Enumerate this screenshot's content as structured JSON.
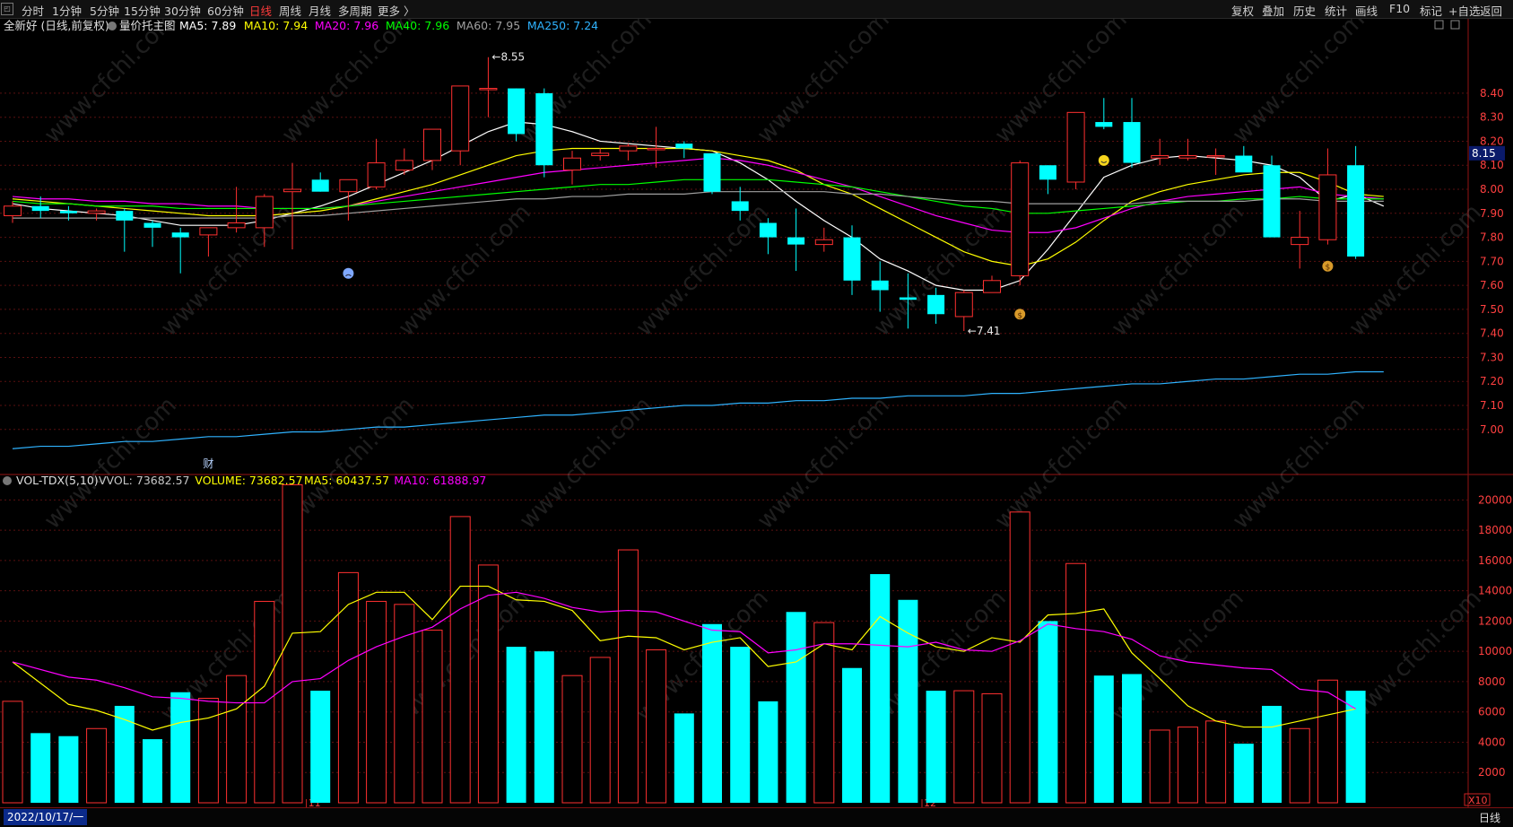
{
  "toolbar": {
    "left_items": [
      "分时",
      "1分钟",
      "5分钟",
      "15分钟",
      "30分钟",
      "60分钟",
      "日线",
      "周线",
      "月线",
      "多周期",
      "更多 〉"
    ],
    "active_index": 6,
    "right_items": [
      "复权",
      "叠加",
      "历史",
      "统计",
      "画线",
      "F10",
      "标记",
      "+自选",
      "返回"
    ]
  },
  "main_legend": {
    "stock": "全新好 (日线,前复权)",
    "indicator": "量价托主图",
    "items": [
      {
        "label": "MA5: 7.89",
        "color": "#ffffff"
      },
      {
        "label": "MA10: 7.94",
        "color": "#ffff00"
      },
      {
        "label": "MA20: 7.96",
        "color": "#ff00ff"
      },
      {
        "label": "MA40: 7.96",
        "color": "#00ff00"
      },
      {
        "label": "MA60: 7.95",
        "color": "#a0a0a0"
      },
      {
        "label": "MA250: 7.24",
        "color": "#2fb3ff"
      }
    ]
  },
  "vol_legend": {
    "indicator": "VOL-TDX(5,10)",
    "items": [
      {
        "label": "VVOL: 73682.57",
        "color": "#c8c8c8"
      },
      {
        "label": "VOLUME: 73682.57",
        "color": "#ffff00"
      },
      {
        "label": "MA5: 60437.57",
        "color": "#ffff00"
      },
      {
        "label": "MA10: 61888.97",
        "color": "#ff00ff"
      }
    ]
  },
  "footer": {
    "date": "2022/10/17/一",
    "timeframe": "日线"
  },
  "colors": {
    "up": "#ff3030",
    "down": "#00ffff",
    "grid": "#5a1010",
    "axis": "#ff4040",
    "vol_ma5": "#ffff00",
    "vol_ma10": "#ff00ff"
  },
  "chart_data": [
    {
      "type": "candlestick",
      "ylim": [
        6.82,
        8.62
      ],
      "y_ticks": [
        "8.40",
        "8.30",
        "8.20",
        "8.10",
        "8.00",
        "7.90",
        "7.80",
        "7.70",
        "7.60",
        "7.50",
        "7.40",
        "7.30",
        "7.20",
        "7.10",
        "7.00"
      ],
      "last_price": "8.15",
      "month_labels": [
        {
          "index": 11,
          "label": "11"
        },
        {
          "index": 33,
          "label": "12"
        }
      ],
      "annotations": [
        {
          "index": 17,
          "value": 8.55,
          "label": "8.55"
        },
        {
          "index": 34,
          "value": 7.41,
          "label": "7.41"
        }
      ],
      "markers": [
        {
          "index": 12,
          "value": 7.65,
          "icon": "sad-face"
        },
        {
          "index": 36,
          "value": 7.48,
          "icon": "money-bag"
        },
        {
          "index": 39,
          "value": 8.12,
          "icon": "smiley-face"
        },
        {
          "index": 47,
          "value": 7.68,
          "icon": "money-bag"
        }
      ],
      "text_markers": [
        {
          "index": 7,
          "label": "财"
        }
      ],
      "candles": [
        {
          "o": 7.89,
          "h": 7.95,
          "l": 7.86,
          "c": 7.93
        },
        {
          "o": 7.93,
          "h": 7.97,
          "l": 7.88,
          "c": 7.91
        },
        {
          "o": 7.91,
          "h": 7.93,
          "l": 7.87,
          "c": 7.9
        },
        {
          "o": 7.9,
          "h": 7.92,
          "l": 7.87,
          "c": 7.91
        },
        {
          "o": 7.91,
          "h": 7.92,
          "l": 7.74,
          "c": 7.87
        },
        {
          "o": 7.86,
          "h": 7.87,
          "l": 7.76,
          "c": 7.84
        },
        {
          "o": 7.82,
          "h": 7.84,
          "l": 7.65,
          "c": 7.8
        },
        {
          "o": 7.81,
          "h": 7.84,
          "l": 7.72,
          "c": 7.84
        },
        {
          "o": 7.84,
          "h": 8.01,
          "l": 7.82,
          "c": 7.86
        },
        {
          "o": 7.84,
          "h": 7.98,
          "l": 7.76,
          "c": 7.97
        },
        {
          "o": 7.99,
          "h": 8.11,
          "l": 7.75,
          "c": 8.0
        },
        {
          "o": 8.04,
          "h": 8.07,
          "l": 7.99,
          "c": 7.99
        },
        {
          "o": 7.99,
          "h": 8.04,
          "l": 7.87,
          "c": 8.04
        },
        {
          "o": 8.01,
          "h": 8.21,
          "l": 8.0,
          "c": 8.11
        },
        {
          "o": 8.08,
          "h": 8.17,
          "l": 8.06,
          "c": 8.12
        },
        {
          "o": 8.12,
          "h": 8.25,
          "l": 8.08,
          "c": 8.25
        },
        {
          "o": 8.16,
          "h": 8.43,
          "l": 8.1,
          "c": 8.43
        },
        {
          "o": 8.42,
          "h": 8.55,
          "l": 8.3,
          "c": 8.42
        },
        {
          "o": 8.42,
          "h": 8.42,
          "l": 8.2,
          "c": 8.23
        },
        {
          "o": 8.4,
          "h": 8.42,
          "l": 8.05,
          "c": 8.1
        },
        {
          "o": 8.08,
          "h": 8.16,
          "l": 8.02,
          "c": 8.13
        },
        {
          "o": 8.14,
          "h": 8.17,
          "l": 8.12,
          "c": 8.15
        },
        {
          "o": 8.16,
          "h": 8.19,
          "l": 8.12,
          "c": 8.18
        },
        {
          "o": 8.17,
          "h": 8.26,
          "l": 8.09,
          "c": 8.17
        },
        {
          "o": 8.19,
          "h": 8.2,
          "l": 8.13,
          "c": 8.17
        },
        {
          "o": 8.15,
          "h": 8.15,
          "l": 7.98,
          "c": 7.99
        },
        {
          "o": 7.95,
          "h": 8.01,
          "l": 7.87,
          "c": 7.91
        },
        {
          "o": 7.86,
          "h": 7.88,
          "l": 7.73,
          "c": 7.8
        },
        {
          "o": 7.8,
          "h": 7.92,
          "l": 7.66,
          "c": 7.77
        },
        {
          "o": 7.77,
          "h": 7.84,
          "l": 7.74,
          "c": 7.79
        },
        {
          "o": 7.8,
          "h": 7.85,
          "l": 7.56,
          "c": 7.62
        },
        {
          "o": 7.62,
          "h": 7.7,
          "l": 7.49,
          "c": 7.58
        },
        {
          "o": 7.55,
          "h": 7.65,
          "l": 7.42,
          "c": 7.54
        },
        {
          "o": 7.56,
          "h": 7.59,
          "l": 7.44,
          "c": 7.48
        },
        {
          "o": 7.47,
          "h": 7.58,
          "l": 7.41,
          "c": 7.57
        },
        {
          "o": 7.57,
          "h": 7.64,
          "l": 7.57,
          "c": 7.62
        },
        {
          "o": 7.64,
          "h": 8.12,
          "l": 7.6,
          "c": 8.11
        },
        {
          "o": 8.1,
          "h": 8.1,
          "l": 7.98,
          "c": 8.04
        },
        {
          "o": 8.03,
          "h": 8.32,
          "l": 8.0,
          "c": 8.32
        },
        {
          "o": 8.28,
          "h": 8.38,
          "l": 8.25,
          "c": 8.26
        },
        {
          "o": 8.28,
          "h": 8.38,
          "l": 8.09,
          "c": 8.11
        },
        {
          "o": 8.13,
          "h": 8.21,
          "l": 8.1,
          "c": 8.14
        },
        {
          "o": 8.13,
          "h": 8.21,
          "l": 8.12,
          "c": 8.14
        },
        {
          "o": 8.14,
          "h": 8.17,
          "l": 8.06,
          "c": 8.14
        },
        {
          "o": 8.14,
          "h": 8.18,
          "l": 8.09,
          "c": 8.07
        },
        {
          "o": 8.1,
          "h": 8.14,
          "l": 7.95,
          "c": 7.8
        },
        {
          "o": 7.77,
          "h": 7.91,
          "l": 7.67,
          "c": 7.8
        },
        {
          "o": 7.79,
          "h": 8.17,
          "l": 7.77,
          "c": 8.06
        },
        {
          "o": 8.1,
          "h": 8.18,
          "l": 7.71,
          "c": 7.72
        }
      ],
      "series": [
        {
          "name": "MA5",
          "color": "#ffffff",
          "values": [
            7.94,
            7.92,
            7.91,
            7.9,
            7.89,
            7.87,
            7.85,
            7.85,
            7.85,
            7.87,
            7.9,
            7.93,
            7.97,
            8.02,
            8.07,
            8.12,
            8.18,
            8.24,
            8.28,
            8.27,
            8.24,
            8.2,
            8.19,
            8.18,
            8.17,
            8.16,
            8.11,
            8.04,
            7.95,
            7.87,
            7.8,
            7.71,
            7.66,
            7.6,
            7.58,
            7.58,
            7.62,
            7.75,
            7.9,
            8.05,
            8.1,
            8.13,
            8.14,
            8.13,
            8.12,
            8.1,
            8.05,
            7.95,
            7.98,
            7.93
          ]
        },
        {
          "name": "MA10",
          "color": "#ffff00",
          "values": [
            7.96,
            7.95,
            7.94,
            7.93,
            7.92,
            7.91,
            7.9,
            7.89,
            7.89,
            7.89,
            7.9,
            7.91,
            7.93,
            7.96,
            7.99,
            8.02,
            8.06,
            8.1,
            8.14,
            8.16,
            8.17,
            8.17,
            8.17,
            8.17,
            8.17,
            8.16,
            8.14,
            8.12,
            8.08,
            8.02,
            7.98,
            7.92,
            7.86,
            7.8,
            7.74,
            7.7,
            7.68,
            7.71,
            7.78,
            7.87,
            7.95,
            7.99,
            8.02,
            8.04,
            8.06,
            8.07,
            8.07,
            8.03,
            7.98,
            7.97
          ]
        },
        {
          "name": "MA20",
          "color": "#ff00ff",
          "values": [
            7.97,
            7.96,
            7.96,
            7.95,
            7.95,
            7.94,
            7.94,
            7.93,
            7.93,
            7.92,
            7.92,
            7.92,
            7.93,
            7.95,
            7.97,
            7.99,
            8.01,
            8.03,
            8.05,
            8.07,
            8.08,
            8.09,
            8.1,
            8.11,
            8.12,
            8.13,
            8.12,
            8.1,
            8.07,
            8.04,
            8.01,
            7.97,
            7.93,
            7.89,
            7.86,
            7.83,
            7.82,
            7.82,
            7.84,
            7.88,
            7.92,
            7.95,
            7.97,
            7.98,
            7.99,
            8.0,
            8.01,
            7.98,
            7.97,
            7.96
          ]
        },
        {
          "name": "MA40",
          "color": "#00ff00",
          "values": [
            7.95,
            7.94,
            7.94,
            7.93,
            7.93,
            7.93,
            7.92,
            7.92,
            7.92,
            7.92,
            7.92,
            7.92,
            7.93,
            7.94,
            7.95,
            7.96,
            7.97,
            7.98,
            7.99,
            8.0,
            8.01,
            8.02,
            8.02,
            8.03,
            8.04,
            8.04,
            8.04,
            8.04,
            8.03,
            8.02,
            8.01,
            7.99,
            7.97,
            7.95,
            7.93,
            7.92,
            7.9,
            7.9,
            7.91,
            7.92,
            7.93,
            7.94,
            7.95,
            7.95,
            7.96,
            7.96,
            7.97,
            7.96,
            7.96,
            7.96
          ]
        },
        {
          "name": "MA60",
          "color": "#a0a0a0",
          "values": [
            7.88,
            7.88,
            7.88,
            7.88,
            7.88,
            7.88,
            7.88,
            7.88,
            7.88,
            7.88,
            7.89,
            7.89,
            7.9,
            7.91,
            7.92,
            7.93,
            7.94,
            7.95,
            7.96,
            7.96,
            7.97,
            7.97,
            7.98,
            7.98,
            7.98,
            7.99,
            7.99,
            7.99,
            7.99,
            7.99,
            7.98,
            7.98,
            7.97,
            7.96,
            7.95,
            7.95,
            7.94,
            7.94,
            7.94,
            7.94,
            7.94,
            7.95,
            7.95,
            7.95,
            7.95,
            7.96,
            7.96,
            7.95,
            7.95,
            7.95
          ]
        },
        {
          "name": "MA250",
          "color": "#2fb3ff",
          "values": [
            6.92,
            6.93,
            6.93,
            6.94,
            6.95,
            6.95,
            6.96,
            6.97,
            6.97,
            6.98,
            6.99,
            6.99,
            7.0,
            7.01,
            7.01,
            7.02,
            7.03,
            7.04,
            7.05,
            7.06,
            7.06,
            7.07,
            7.08,
            7.09,
            7.1,
            7.1,
            7.11,
            7.11,
            7.12,
            7.12,
            7.13,
            7.13,
            7.14,
            7.14,
            7.14,
            7.15,
            7.15,
            7.16,
            7.17,
            7.18,
            7.19,
            7.19,
            7.2,
            7.21,
            7.21,
            7.22,
            7.23,
            7.23,
            7.24,
            7.24
          ]
        }
      ]
    },
    {
      "type": "bar",
      "ylim": [
        0,
        21500
      ],
      "y_ticks": [
        "20000",
        "18000",
        "16000",
        "14000",
        "12000",
        "10000",
        "8000",
        "6000",
        "4000",
        "2000"
      ],
      "unit_label": "X10",
      "values": [
        6700,
        4600,
        4400,
        4900,
        6400,
        4200,
        7300,
        6900,
        8400,
        13300,
        21000,
        7400,
        15200,
        13300,
        13100,
        11400,
        18900,
        15700,
        10300,
        10000,
        8400,
        9600,
        16700,
        10100,
        5900,
        11800,
        10300,
        6700,
        12600,
        11900,
        8900,
        15100,
        13400,
        7400,
        7400,
        7200,
        19200,
        12000,
        15800,
        8400,
        8500,
        4800,
        5000,
        5400,
        3900,
        6400,
        4900,
        8100,
        7400
      ],
      "series": [
        {
          "name": "MA5",
          "color": "#ffff00",
          "values": [
            9300,
            null,
            6500,
            6100,
            5500,
            4800,
            5300,
            5600,
            6200,
            7700,
            11200,
            11300,
            13100,
            13900,
            13900,
            12100,
            14300,
            14300,
            13400,
            13300,
            12700,
            10700,
            11000,
            10900,
            10100,
            10600,
            10900,
            9000,
            9300,
            10500,
            10100,
            12300,
            11200,
            10300,
            10000,
            10900,
            10600,
            12400,
            12500,
            12800,
            9900,
            8200,
            6400,
            5400,
            5000,
            5000,
            5400,
            5800,
            6200
          ]
        },
        {
          "name": "MA10",
          "color": "#ff00ff",
          "values": [
            9300,
            null,
            8300,
            8100,
            7600,
            7000,
            6900,
            6700,
            6600,
            6600,
            8000,
            8200,
            9400,
            10300,
            11000,
            11600,
            12800,
            13700,
            13900,
            13500,
            12900,
            12600,
            12700,
            12600,
            12000,
            11400,
            11300,
            9900,
            10100,
            10500,
            10500,
            10400,
            10300,
            10600,
            10100,
            10000,
            10700,
            11800,
            11500,
            11300,
            10800,
            9700,
            9300,
            9100,
            8900,
            8800,
            7500,
            7300,
            6200
          ]
        }
      ]
    }
  ]
}
